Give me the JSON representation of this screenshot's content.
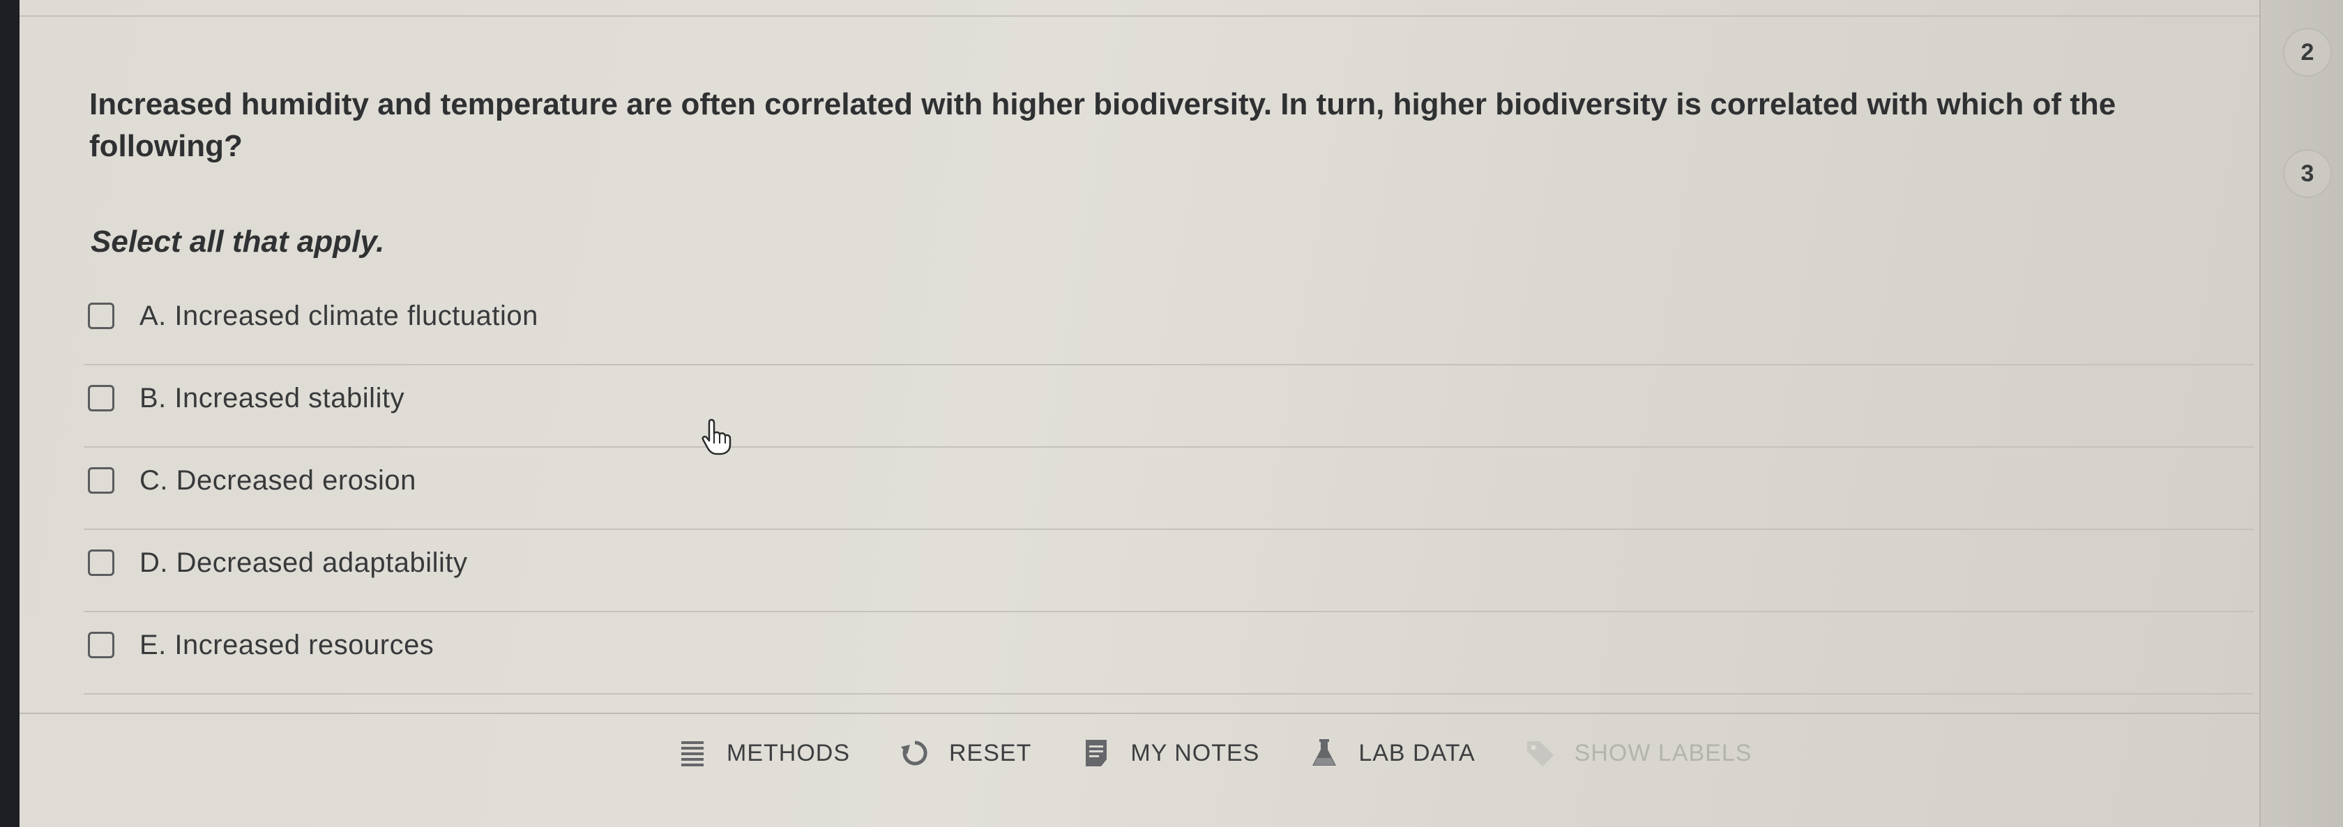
{
  "question": {
    "text": "Increased humidity and temperature are often correlated with higher biodiversity. In turn, higher biodiversity is correlated with which of the following?",
    "instruction": "Select all that apply."
  },
  "options": [
    {
      "label": "A. Increased climate fluctuation",
      "checked": false
    },
    {
      "label": "B. Increased stability",
      "checked": false
    },
    {
      "label": "C. Decreased erosion",
      "checked": false
    },
    {
      "label": "D. Decreased adaptability",
      "checked": false
    },
    {
      "label": "E. Increased resources",
      "checked": false
    }
  ],
  "toolbar": {
    "methods": {
      "label": "METHODS",
      "icon": "methods-icon"
    },
    "reset": {
      "label": "RESET",
      "icon": "reset-icon"
    },
    "my_notes": {
      "label": "MY NOTES",
      "icon": "notes-icon"
    },
    "lab_data": {
      "label": "LAB DATA",
      "icon": "flask-icon"
    },
    "show_labels": {
      "label": "SHOW LABELS",
      "icon": "tag-icon",
      "disabled": true
    }
  },
  "navigation": {
    "pages": [
      "2",
      "3"
    ]
  },
  "colors": {
    "text": "#2f3032",
    "panel": "#dddbd3",
    "disabled": "#b4b3ae"
  }
}
